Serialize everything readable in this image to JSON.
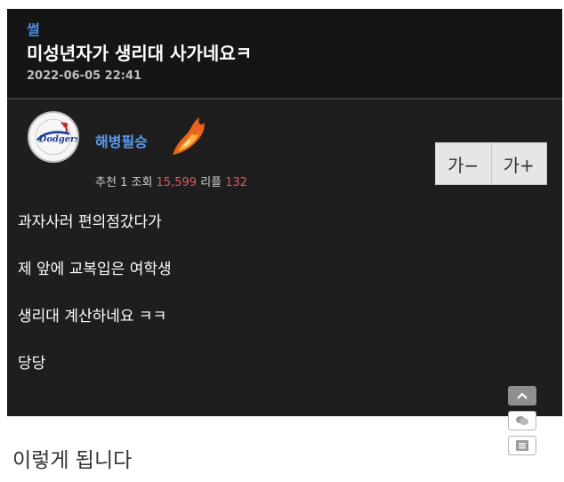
{
  "post": {
    "category": "썰",
    "title": "미성년자가 생리대 사가네요ㅋ",
    "date": "2022-06-05 22:41",
    "author": {
      "nickname": "해병필승",
      "avatar_icon": "dodgers-logo-icon",
      "badge_icon": "fire-badge-icon"
    },
    "stats": {
      "recommend_label": "추천",
      "recommend_value": "1",
      "views_label": "조회",
      "views_value": "15,599",
      "replies_label": "리플",
      "replies_value": "132"
    },
    "font_controls": {
      "decrease_label": "가−",
      "increase_label": "가+"
    },
    "body": [
      "과자사러 편의점갔다가",
      "제 앞에 교복입은 여학생",
      "생리대 계산하네요 ㅋㅋ",
      "당당"
    ]
  },
  "caption": "이렇게 됩니다",
  "side_buttons": [
    {
      "icon": "chevron-up-icon"
    },
    {
      "icon": "comments-icon"
    },
    {
      "icon": "list-icon"
    }
  ],
  "colors": {
    "category": "#4d8fe0",
    "nickname": "#5b9cf0",
    "stat_number": "#e05a5a",
    "post_background": "#1e1e1e",
    "header_background": "#151515"
  }
}
